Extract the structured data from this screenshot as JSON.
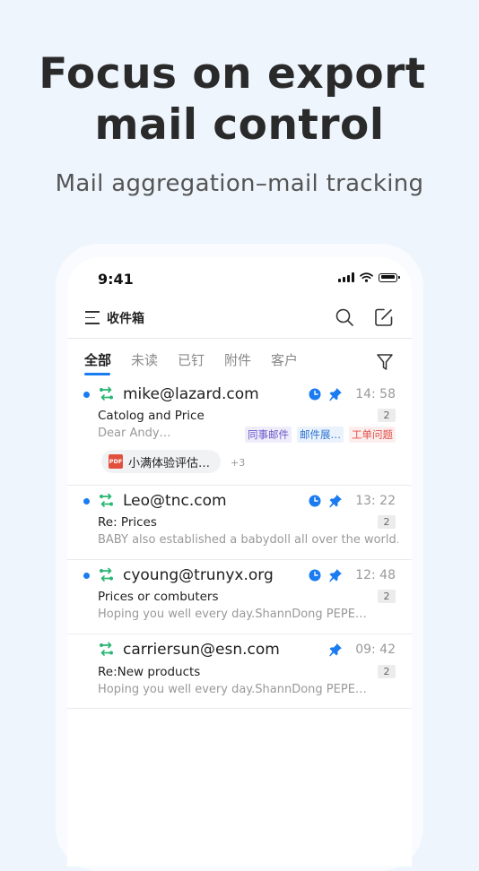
{
  "hero": {
    "title_line1": "Focus on export",
    "title_line2": "mail control",
    "subtitle": "Mail aggregation–mail tracking"
  },
  "status_bar": {
    "time": "9:41"
  },
  "header": {
    "title": "收件箱",
    "menu_icon": "menu-icon",
    "search_icon": "search-icon",
    "compose_icon": "compose-icon"
  },
  "tabs": [
    {
      "label": "全部",
      "active": true
    },
    {
      "label": "未读",
      "active": false
    },
    {
      "label": "已钉",
      "active": false
    },
    {
      "label": "附件",
      "active": false
    },
    {
      "label": "客户",
      "active": false
    }
  ],
  "colors": {
    "accent": "#1a7cf0",
    "track_green": "#2bb673"
  },
  "mails": [
    {
      "sender": "mike@lazard.com",
      "subject": "Catolog and Price",
      "preview": "Dear Andy…",
      "time": "14: 58",
      "count": "2",
      "unread": true,
      "reminder": true,
      "pinned": true,
      "tags": [
        "同事邮件",
        "邮件展…",
        "工单问题"
      ],
      "attachment": {
        "name": "小满体验评估…",
        "more": "+3"
      }
    },
    {
      "sender": "Leo@tnc.com",
      "subject": "Re: Prices",
      "preview": "BABY also established a babydoll all over the world…",
      "time": "13: 22",
      "count": "2",
      "unread": true,
      "reminder": true,
      "pinned": true
    },
    {
      "sender": "cyoung@trunyx.org",
      "subject": "Prices or combuters",
      "preview": "Hoping you well every day.ShannDong PEPE…",
      "time": "12: 48",
      "count": "2",
      "unread": true,
      "reminder": true,
      "pinned": true
    },
    {
      "sender": "carriersun@esn.com",
      "subject": "Re:New products",
      "preview": "Hoping you well every day.ShannDong PEPE…",
      "time": "09: 42",
      "count": "2",
      "unread": false,
      "reminder": false,
      "pinned": true
    }
  ]
}
